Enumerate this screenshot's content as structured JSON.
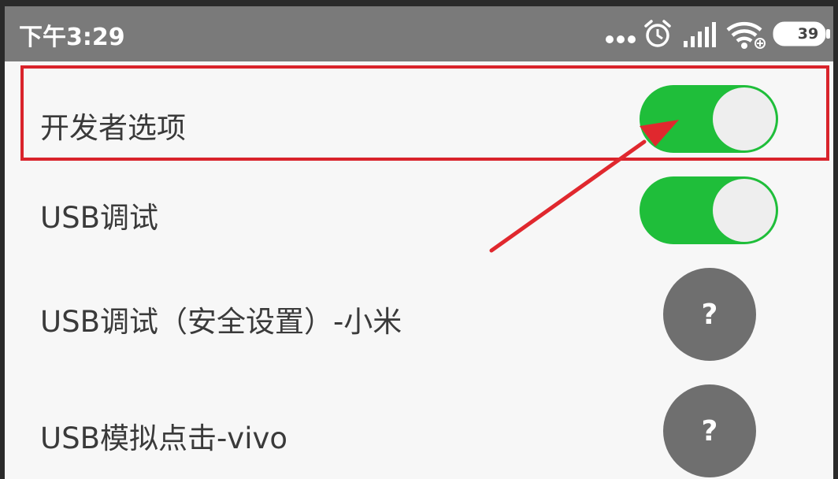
{
  "status_bar": {
    "time": "下午3:29",
    "icons": [
      "more-dots-icon",
      "alarm-icon",
      "signal-icon",
      "wifi-icon",
      "battery-icon"
    ],
    "battery_level": "39"
  },
  "settings": [
    {
      "label": "开发者选项",
      "control": "toggle",
      "state": "on"
    },
    {
      "label": "USB调试",
      "control": "toggle",
      "state": "on"
    },
    {
      "label": "USB调试（安全设置）-小米",
      "control": "help",
      "symbol": "?"
    },
    {
      "label": "USB模拟点击-vivo",
      "control": "help",
      "symbol": "?"
    }
  ],
  "annotation": {
    "highlight_color": "#d9232b",
    "arrow_color": "#e0282e",
    "target": "开发者选项"
  },
  "colors": {
    "toggle_on": "#1fbe3a",
    "status_bar": "#7a7a7a",
    "background": "#f7f7f7",
    "help_button": "#6f6f6f"
  }
}
